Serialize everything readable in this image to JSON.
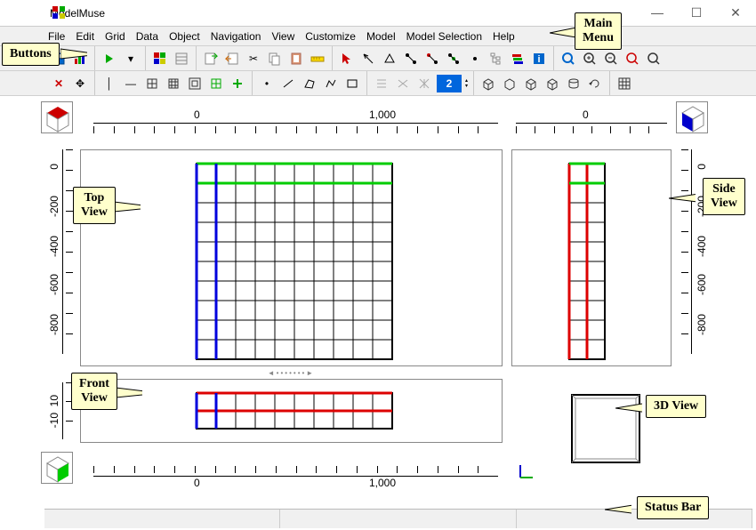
{
  "window": {
    "title": "ModelMuse"
  },
  "menu": {
    "items": [
      "File",
      "Edit",
      "Grid",
      "Data",
      "Object",
      "Navigation",
      "View",
      "Customize",
      "Model",
      "Model Selection",
      "Help"
    ]
  },
  "toolbar": {
    "layer_value": "2"
  },
  "ruler": {
    "top_label_left": "0",
    "top_label_right": "1,000",
    "side_label": "0",
    "y_labels": [
      "0",
      "-200",
      "-400",
      "-600",
      "-800"
    ],
    "front_y_labels": [
      "-10",
      "10"
    ],
    "side_y_labels": [
      "0",
      "-200",
      "-400",
      "-600",
      "-800"
    ],
    "bottom_label_left": "0",
    "bottom_label_right": "1,000"
  },
  "annotations": {
    "buttons": "Buttons",
    "main_menu": "Main\nMenu",
    "top_view": "Top\nView",
    "side_view": "Side\nView",
    "front_view": "Front\nView",
    "three_d_view": "3D View",
    "status_bar": "Status Bar"
  }
}
